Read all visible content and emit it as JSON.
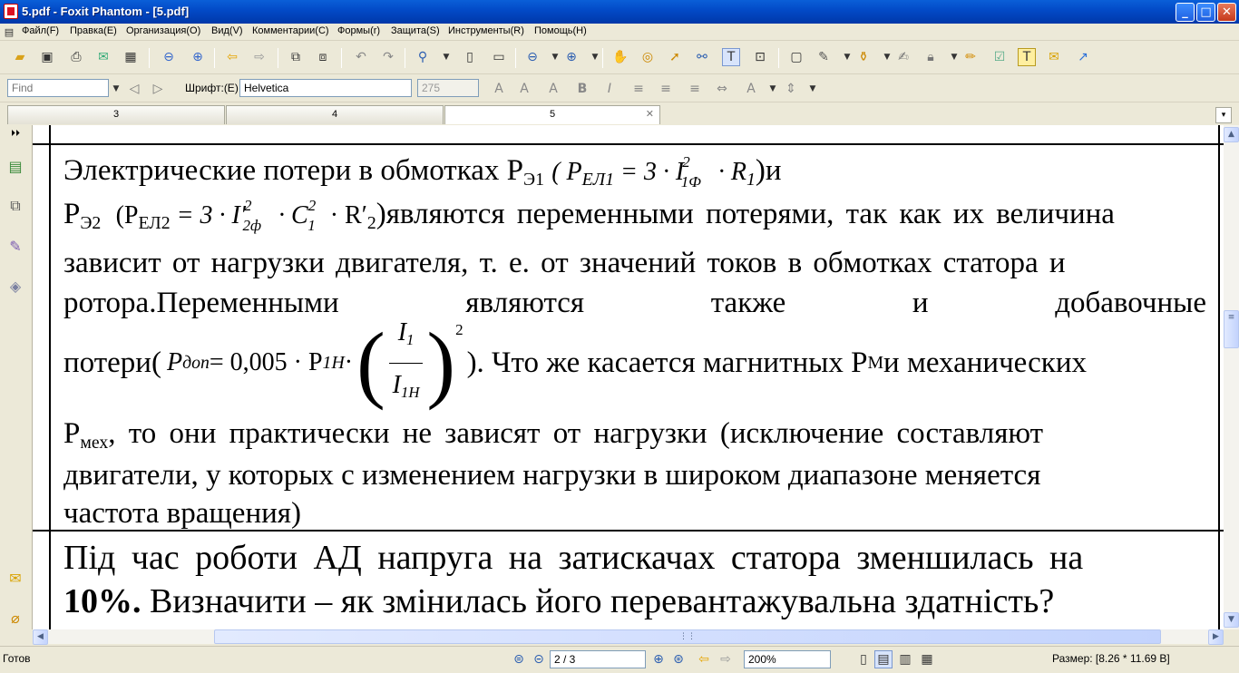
{
  "window": {
    "title": "5.pdf - Foxit Phantom - [5.pdf]",
    "min": "_",
    "max": "□",
    "close": "✕"
  },
  "menu": [
    "Файл(F)",
    "Правка(E)",
    "Организация(O)",
    "Вид(V)",
    "Комментарии(C)",
    "Формы(r)",
    "Защита(S)",
    "Инструменты(R)",
    "Помощь(H)"
  ],
  "find": {
    "placeholder": "Find"
  },
  "font": {
    "label": "Шрифт:(E)",
    "name": "Helvetica",
    "size": "275"
  },
  "tabs": [
    "3",
    "4",
    "5"
  ],
  "doc": {
    "l1_pre": "Электрические потери в обмотках Р",
    "l1_sub": "Э1",
    "l1_formula": "( P",
    "l1_f_sub": "ЕЛ1",
    "l1_f_rest": " = 3 · I",
    "l1_f_sup": "2",
    "l1_f_sub2": "1Ф",
    "l1_f_end": " · R",
    "l1_f_sub3": "1",
    "l1_post": ")и",
    "l2_a": "Р",
    "l2_a_sub": "Э2",
    "l2_f": "(Р",
    "l2_f_sub": "ЕЛ2",
    "l2_f_mid": " = 3 · I′",
    "l2_f_sup": "2",
    "l2_f_sub2": "2ф",
    "l2_f_c": " · C",
    "l2_f_c_sup": "2",
    "l2_f_c_sub": "1",
    "l2_f_r": " · R′",
    "l2_f_r_sub": "2",
    "l2_text": ")являются переменными потерями, так как их величина",
    "l3": "зависит от нагрузки двигателя, т. е. от значений токов в обмотках статора и",
    "l4": [
      "ротора.Переменными",
      "являются",
      "также",
      "и",
      "добавочные"
    ],
    "l5_pre": "потери(",
    "l5_p": "P",
    "l5_p_sub": "доп",
    "l5_eq": " = 0,005 · P",
    "l5_eq_sub": "1Н",
    "l5_dot": " ·",
    "l5_num": "I",
    "l5_num_sub": "1",
    "l5_den": "I",
    "l5_den_sub": "1Н",
    "l5_sq": "2",
    "l5_post": "). Что же касается магнитных Р",
    "l5_m": "М",
    "l5_post2": " и механических",
    "l6_a": "Р",
    "l6_sub": "мех",
    "l6": ", то они практически не зависят от нагрузки (исключение составляют",
    "l7": "двигатели, у которых с изменением нагрузки в широком диапазоне меняется",
    "l8": "частота вращения)",
    "q1": "Під час роботи АД напруга на затискачах статора зменшилась на",
    "q2_b": "10%.",
    "q2": " Визначити – як змінилась його перевантажувальна здатність?"
  },
  "status": {
    "ready": "Готов",
    "page": "2 / 3",
    "zoom": "200%",
    "size": "Размер: [8.26 * 11.69 В]"
  }
}
